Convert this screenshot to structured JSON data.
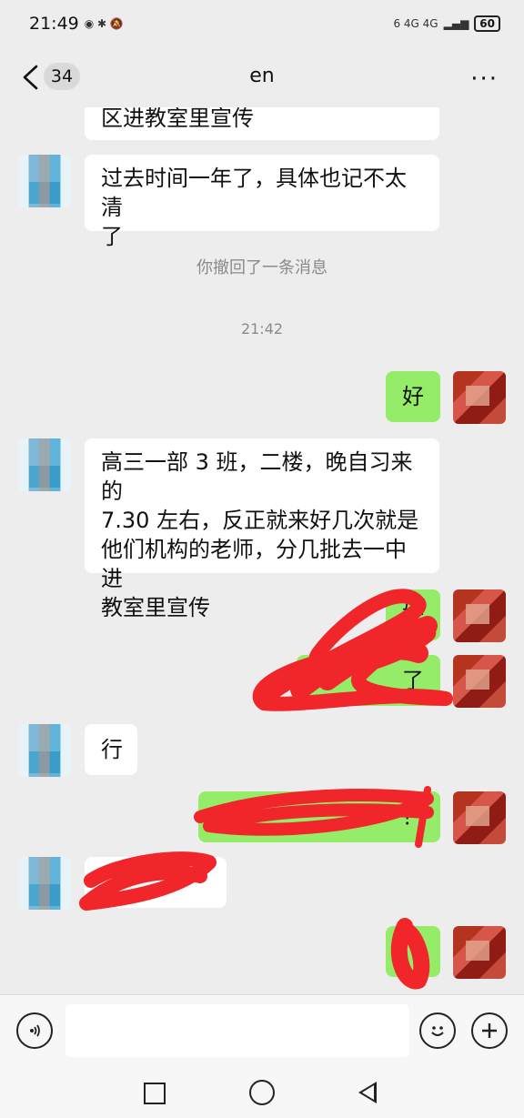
{
  "status_bar": {
    "time": "21:49",
    "right_indicators": "6 4G 4G",
    "battery": "60"
  },
  "header": {
    "unread_count": "34",
    "title": "en",
    "more": "···"
  },
  "messages": [
    {
      "from": "other",
      "text": "区进教室里宣传"
    },
    {
      "from": "other",
      "line1": "过去时间一年了，具体也记不太清",
      "line2": "了"
    },
    {
      "type": "system",
      "text": "你撤回了一条消息"
    },
    {
      "type": "time",
      "text": "21:42"
    },
    {
      "from": "me",
      "text": "好"
    },
    {
      "from": "other",
      "line1": "高三一部 3 班，二楼，晚自习来的",
      "line2": "7.30 左右，反正就来好几次就是",
      "line3": "他们机构的老师，分几批去一中进",
      "line4": "教室里宣传"
    },
    {
      "from": "me",
      "text": "好"
    },
    {
      "from": "me",
      "text": "了"
    },
    {
      "from": "other",
      "text": "行"
    },
    {
      "from": "me",
      "text": "？"
    },
    {
      "from": "other",
      "text": ""
    },
    {
      "from": "me",
      "text": ""
    }
  ],
  "icons": {
    "back": "chevron-left-icon",
    "voice": "voice-icon",
    "emoji": "emoji-icon",
    "plus": "plus-icon"
  },
  "colors": {
    "my_bubble": "#95ec69",
    "other_bubble": "#ffffff",
    "background": "#ededed",
    "redaction": "#f0262a"
  }
}
